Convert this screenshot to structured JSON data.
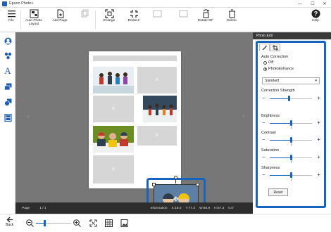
{
  "window": {
    "title": "Epson Photo+",
    "minimize": "—",
    "maximize": "☐",
    "close": "✕"
  },
  "toolbar": {
    "file": "File",
    "auto_layout": "Auto Photo\nLayout",
    "add_page": "Add Page",
    "enlarge": "Enlarge",
    "reduce": "Reduce",
    "rotate": "Rotate 90°",
    "delete": "Delete",
    "help": "Help"
  },
  "status": {
    "page_label": "Page",
    "page_value": "1 / 1",
    "info": "Information",
    "x": "X:18.0",
    "y": "Y:77.3",
    "w": "W:66.9",
    "h": "H:67.3",
    "angle": "0.0°"
  },
  "bottom": {
    "back": "Back"
  },
  "panel": {
    "header": "Photo Edit",
    "auto_correction": "Auto Correction",
    "off": "Off",
    "photo_enhance": "PhotoEnhance",
    "mode": "Standard",
    "correction_strength": "Correction Strength",
    "brightness": "Brightness",
    "contrast": "Contrast",
    "saturation": "Saturation",
    "sharpness": "Sharpness",
    "reset": "Reset",
    "sliders": {
      "correction_strength": 0.45,
      "brightness": 0.5,
      "contrast": 0.5,
      "saturation": 0.5,
      "sharpness": 0.5
    }
  },
  "placeholder_letter": "A",
  "colors": {
    "accent": "#1565c0",
    "canvas": "#777777",
    "status_bg": "#2d2d2d"
  }
}
